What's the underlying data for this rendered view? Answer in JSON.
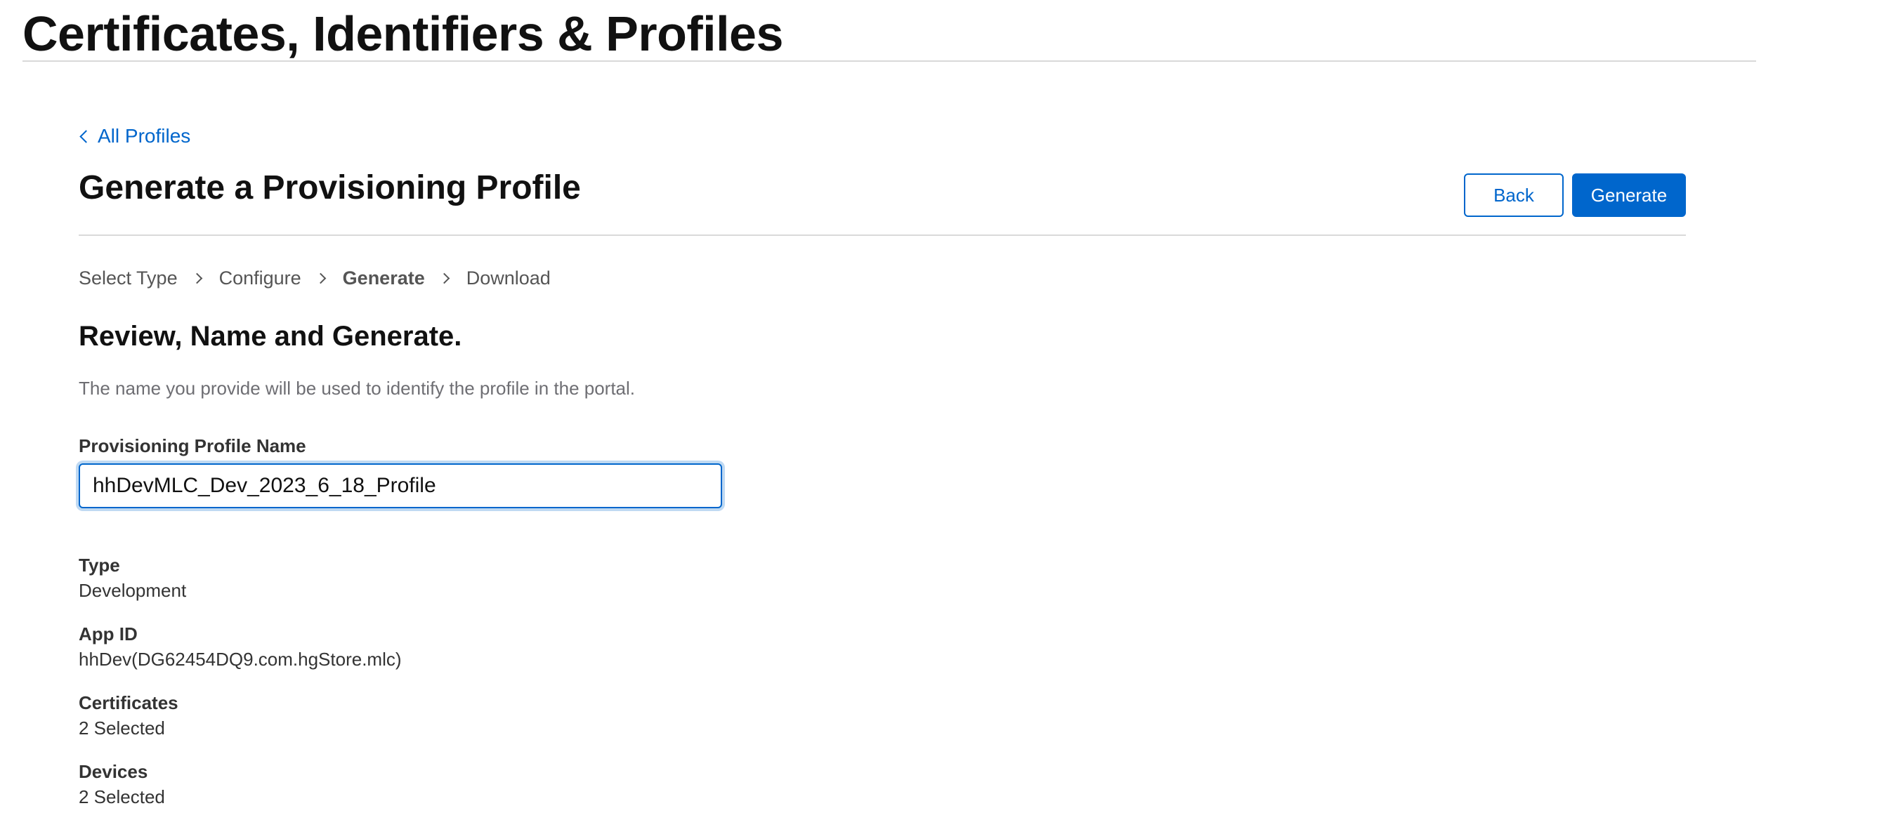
{
  "header": {
    "title": "Certificates, Identifiers & Profiles"
  },
  "nav": {
    "back_link": "All Profiles"
  },
  "section": {
    "title": "Generate a Provisioning Profile"
  },
  "actions": {
    "back_label": "Back",
    "generate_label": "Generate"
  },
  "steps": [
    {
      "label": "Select Type",
      "active": false
    },
    {
      "label": "Configure",
      "active": false
    },
    {
      "label": "Generate",
      "active": true
    },
    {
      "label": "Download",
      "active": false
    }
  ],
  "review": {
    "heading": "Review, Name and Generate.",
    "description": "The name you provide will be used to identify the profile in the portal."
  },
  "form": {
    "name_label": "Provisioning Profile Name",
    "name_value": "hhDevMLC_Dev_2023_6_18_Profile"
  },
  "details": {
    "type_label": "Type",
    "type_value": "Development",
    "app_id_label": "App ID",
    "app_id_value": "hhDev(DG62454DQ9.com.hgStore.mlc)",
    "certificates_label": "Certificates",
    "certificates_value": "2 Selected",
    "devices_label": "Devices",
    "devices_value": "2 Selected"
  },
  "colors": {
    "accent": "#0066cc",
    "text": "#111111",
    "muted": "#6e6e73",
    "divider": "#d9d9d9"
  }
}
